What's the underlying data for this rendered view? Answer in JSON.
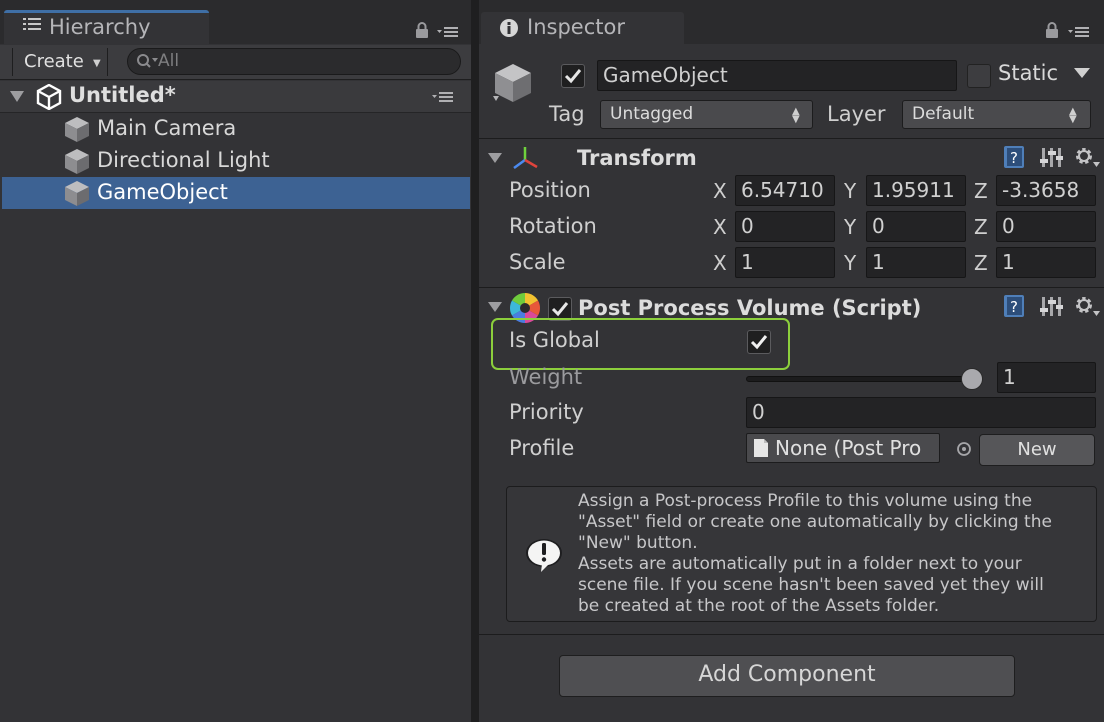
{
  "hierarchy": {
    "tab_label": "Hierarchy",
    "create_label": "Create",
    "search_placeholder": "All",
    "scene_name": "Untitled*",
    "items": [
      {
        "label": "Main Camera"
      },
      {
        "label": "Directional Light"
      },
      {
        "label": "GameObject",
        "selected": true
      }
    ]
  },
  "inspector": {
    "tab_label": "Inspector",
    "object_name": "GameObject",
    "active": true,
    "static_label": "Static",
    "static_checked": false,
    "tag_label": "Tag",
    "tag_value": "Untagged",
    "layer_label": "Layer",
    "layer_value": "Default",
    "transform": {
      "title": "Transform",
      "rows": [
        {
          "label": "Position",
          "x": "6.54710",
          "y": "1.95911",
          "z": "-3.3658"
        },
        {
          "label": "Rotation",
          "x": "0",
          "y": "0",
          "z": "0"
        },
        {
          "label": "Scale",
          "x": "1",
          "y": "1",
          "z": "1"
        }
      ],
      "axis_x": "X",
      "axis_y": "Y",
      "axis_z": "Z"
    },
    "post_process": {
      "title": "Post Process Volume (Script)",
      "enabled": true,
      "is_global_label": "Is Global",
      "is_global": true,
      "weight_label": "Weight",
      "weight_value": "1",
      "weight_fraction": 1,
      "priority_label": "Priority",
      "priority_value": "0",
      "profile_label": "Profile",
      "profile_value": "None (Post Pro",
      "new_button": "New",
      "help_text": "Assign a Post-process Profile to this volume using the\n\"Asset\" field or create one automatically by clicking the\n\"New\" button.\nAssets are automatically put in a folder next to your\nscene file. If you scene hasn't been saved yet they will\nbe created at the root of the Assets folder."
    },
    "add_component_label": "Add Component"
  },
  "colors": {
    "selection": "#3d6293",
    "highlight_outline": "#8ccf3c",
    "panel_bg": "#333336"
  }
}
